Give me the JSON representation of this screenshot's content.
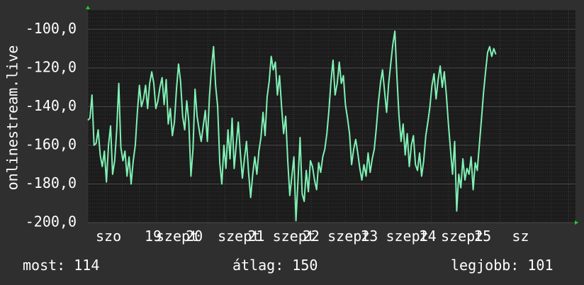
{
  "chart_data": {
    "type": "line",
    "ylabel": "onlinestream.live",
    "ylim": [
      -200,
      -90
    ],
    "yticks": [
      -100,
      -120,
      -140,
      -160,
      -180,
      -200
    ],
    "ytick_labels": [
      "-100,0",
      "-120,0",
      "-140,0",
      "-160,0",
      "-180,0",
      "-200,0"
    ],
    "xlim": [
      0,
      7.1
    ],
    "xticks": [
      {
        "x": 0.3,
        "label": "szo"
      },
      {
        "x": 0.95,
        "label": "19"
      },
      {
        "x": 1.3,
        "label": "szept"
      },
      {
        "x": 1.55,
        "label": "20"
      },
      {
        "x": 2.2,
        "label": "szept"
      },
      {
        "x": 2.45,
        "label": "21"
      },
      {
        "x": 3.0,
        "label": "szept"
      },
      {
        "x": 3.25,
        "label": "22"
      },
      {
        "x": 3.8,
        "label": "szept"
      },
      {
        "x": 4.1,
        "label": "23"
      },
      {
        "x": 4.65,
        "label": "szept"
      },
      {
        "x": 4.95,
        "label": "24"
      },
      {
        "x": 5.45,
        "label": "szept"
      },
      {
        "x": 5.75,
        "label": "25"
      },
      {
        "x": 6.3,
        "label": "sz"
      }
    ],
    "colors": {
      "line": "#7ff0b4",
      "background": "#2f2f2f",
      "plot_bg": "#1c1c1c",
      "grid": "#4a4a4a",
      "axis_arrow": "#22cc22"
    },
    "series": [
      {
        "values": [
          [
            0.0,
            -147
          ],
          [
            0.03,
            -146
          ],
          [
            0.06,
            -134
          ],
          [
            0.09,
            -160
          ],
          [
            0.12,
            -159
          ],
          [
            0.15,
            -152
          ],
          [
            0.18,
            -165
          ],
          [
            0.21,
            -171
          ],
          [
            0.24,
            -163
          ],
          [
            0.27,
            -179
          ],
          [
            0.3,
            -160
          ],
          [
            0.33,
            -150
          ],
          [
            0.36,
            -175
          ],
          [
            0.39,
            -168
          ],
          [
            0.42,
            -152
          ],
          [
            0.45,
            -128
          ],
          [
            0.48,
            -161
          ],
          [
            0.51,
            -168
          ],
          [
            0.54,
            -163
          ],
          [
            0.57,
            -176
          ],
          [
            0.6,
            -166
          ],
          [
            0.63,
            -180
          ],
          [
            0.66,
            -168
          ],
          [
            0.69,
            -160
          ],
          [
            0.72,
            -143
          ],
          [
            0.75,
            -129
          ],
          [
            0.78,
            -140
          ],
          [
            0.81,
            -136
          ],
          [
            0.84,
            -129
          ],
          [
            0.87,
            -141
          ],
          [
            0.9,
            -128
          ],
          [
            0.93,
            -122
          ],
          [
            0.96,
            -128
          ],
          [
            0.99,
            -141
          ],
          [
            1.02,
            -137
          ],
          [
            1.05,
            -130
          ],
          [
            1.08,
            -125
          ],
          [
            1.11,
            -139
          ],
          [
            1.14,
            -126
          ],
          [
            1.17,
            -149
          ],
          [
            1.2,
            -141
          ],
          [
            1.23,
            -155
          ],
          [
            1.26,
            -148
          ],
          [
            1.29,
            -131
          ],
          [
            1.32,
            -118
          ],
          [
            1.35,
            -127
          ],
          [
            1.38,
            -145
          ],
          [
            1.41,
            -152
          ],
          [
            1.44,
            -137
          ],
          [
            1.47,
            -148
          ],
          [
            1.5,
            -176
          ],
          [
            1.53,
            -162
          ],
          [
            1.56,
            -131
          ],
          [
            1.59,
            -145
          ],
          [
            1.62,
            -152
          ],
          [
            1.65,
            -158
          ],
          [
            1.68,
            -150
          ],
          [
            1.71,
            -142
          ],
          [
            1.74,
            -158
          ],
          [
            1.77,
            -135
          ],
          [
            1.8,
            -120
          ],
          [
            1.83,
            -109
          ],
          [
            1.86,
            -129
          ],
          [
            1.89,
            -140
          ],
          [
            1.92,
            -169
          ],
          [
            1.95,
            -180
          ],
          [
            1.98,
            -160
          ],
          [
            2.01,
            -172
          ],
          [
            2.04,
            -152
          ],
          [
            2.07,
            -167
          ],
          [
            2.1,
            -146
          ],
          [
            2.13,
            -172
          ],
          [
            2.16,
            -160
          ],
          [
            2.19,
            -148
          ],
          [
            2.22,
            -164
          ],
          [
            2.25,
            -177
          ],
          [
            2.28,
            -167
          ],
          [
            2.31,
            -158
          ],
          [
            2.34,
            -174
          ],
          [
            2.37,
            -187
          ],
          [
            2.4,
            -175
          ],
          [
            2.43,
            -166
          ],
          [
            2.46,
            -175
          ],
          [
            2.49,
            -163
          ],
          [
            2.52,
            -156
          ],
          [
            2.55,
            -143
          ],
          [
            2.58,
            -155
          ],
          [
            2.61,
            -135
          ],
          [
            2.64,
            -127
          ],
          [
            2.67,
            -114
          ],
          [
            2.7,
            -121
          ],
          [
            2.73,
            -117
          ],
          [
            2.76,
            -134
          ],
          [
            2.79,
            -124
          ],
          [
            2.82,
            -140
          ],
          [
            2.85,
            -154
          ],
          [
            2.88,
            -145
          ],
          [
            2.91,
            -168
          ],
          [
            2.94,
            -186
          ],
          [
            2.97,
            -176
          ],
          [
            3.0,
            -166
          ],
          [
            3.03,
            -199
          ],
          [
            3.06,
            -178
          ],
          [
            3.09,
            -156
          ],
          [
            3.12,
            -185
          ],
          [
            3.15,
            -189
          ],
          [
            3.18,
            -173
          ],
          [
            3.21,
            -184
          ],
          [
            3.24,
            -168
          ],
          [
            3.27,
            -171
          ],
          [
            3.3,
            -178
          ],
          [
            3.33,
            -183
          ],
          [
            3.36,
            -169
          ],
          [
            3.39,
            -174
          ],
          [
            3.42,
            -166
          ],
          [
            3.45,
            -162
          ],
          [
            3.48,
            -154
          ],
          [
            3.51,
            -142
          ],
          [
            3.54,
            -127
          ],
          [
            3.57,
            -116
          ],
          [
            3.6,
            -134
          ],
          [
            3.63,
            -128
          ],
          [
            3.66,
            -117
          ],
          [
            3.69,
            -128
          ],
          [
            3.72,
            -124
          ],
          [
            3.75,
            -139
          ],
          [
            3.78,
            -146
          ],
          [
            3.81,
            -154
          ],
          [
            3.84,
            -170
          ],
          [
            3.87,
            -162
          ],
          [
            3.9,
            -157
          ],
          [
            3.93,
            -164
          ],
          [
            3.96,
            -172
          ],
          [
            3.99,
            -178
          ],
          [
            4.02,
            -170
          ],
          [
            4.05,
            -176
          ],
          [
            4.08,
            -164
          ],
          [
            4.11,
            -174
          ],
          [
            4.14,
            -167
          ],
          [
            4.17,
            -162
          ],
          [
            4.2,
            -151
          ],
          [
            4.23,
            -138
          ],
          [
            4.26,
            -128
          ],
          [
            4.29,
            -121
          ],
          [
            4.32,
            -132
          ],
          [
            4.35,
            -143
          ],
          [
            4.38,
            -128
          ],
          [
            4.41,
            -118
          ],
          [
            4.44,
            -108
          ],
          [
            4.47,
            -101
          ],
          [
            4.5,
            -125
          ],
          [
            4.53,
            -145
          ],
          [
            4.56,
            -158
          ],
          [
            4.59,
            -149
          ],
          [
            4.62,
            -165
          ],
          [
            4.65,
            -154
          ],
          [
            4.68,
            -171
          ],
          [
            4.71,
            -160
          ],
          [
            4.74,
            -155
          ],
          [
            4.77,
            -170
          ],
          [
            4.8,
            -173
          ],
          [
            4.83,
            -164
          ],
          [
            4.86,
            -176
          ],
          [
            4.89,
            -168
          ],
          [
            4.92,
            -155
          ],
          [
            4.95,
            -148
          ],
          [
            4.98,
            -140
          ],
          [
            5.01,
            -129
          ],
          [
            5.04,
            -123
          ],
          [
            5.07,
            -136
          ],
          [
            5.1,
            -126
          ],
          [
            5.13,
            -119
          ],
          [
            5.16,
            -130
          ],
          [
            5.19,
            -122
          ],
          [
            5.22,
            -134
          ],
          [
            5.25,
            -149
          ],
          [
            5.28,
            -162
          ],
          [
            5.31,
            -175
          ],
          [
            5.34,
            -158
          ],
          [
            5.37,
            -194
          ],
          [
            5.4,
            -175
          ],
          [
            5.43,
            -182
          ],
          [
            5.46,
            -167
          ],
          [
            5.49,
            -178
          ],
          [
            5.52,
            -172
          ],
          [
            5.55,
            -175
          ],
          [
            5.58,
            -166
          ],
          [
            5.61,
            -183
          ],
          [
            5.64,
            -169
          ],
          [
            5.67,
            -173
          ],
          [
            5.7,
            -160
          ],
          [
            5.73,
            -147
          ],
          [
            5.76,
            -133
          ],
          [
            5.79,
            -122
          ],
          [
            5.82,
            -112
          ],
          [
            5.85,
            -109
          ],
          [
            5.88,
            -114
          ],
          [
            5.91,
            -110
          ],
          [
            5.94,
            -113
          ]
        ]
      }
    ],
    "stats": {
      "now_label": "most:",
      "now_value": "114",
      "avg_label": "átlag:",
      "avg_value": "150",
      "max_label": "legjobb:",
      "max_value": "101"
    }
  }
}
